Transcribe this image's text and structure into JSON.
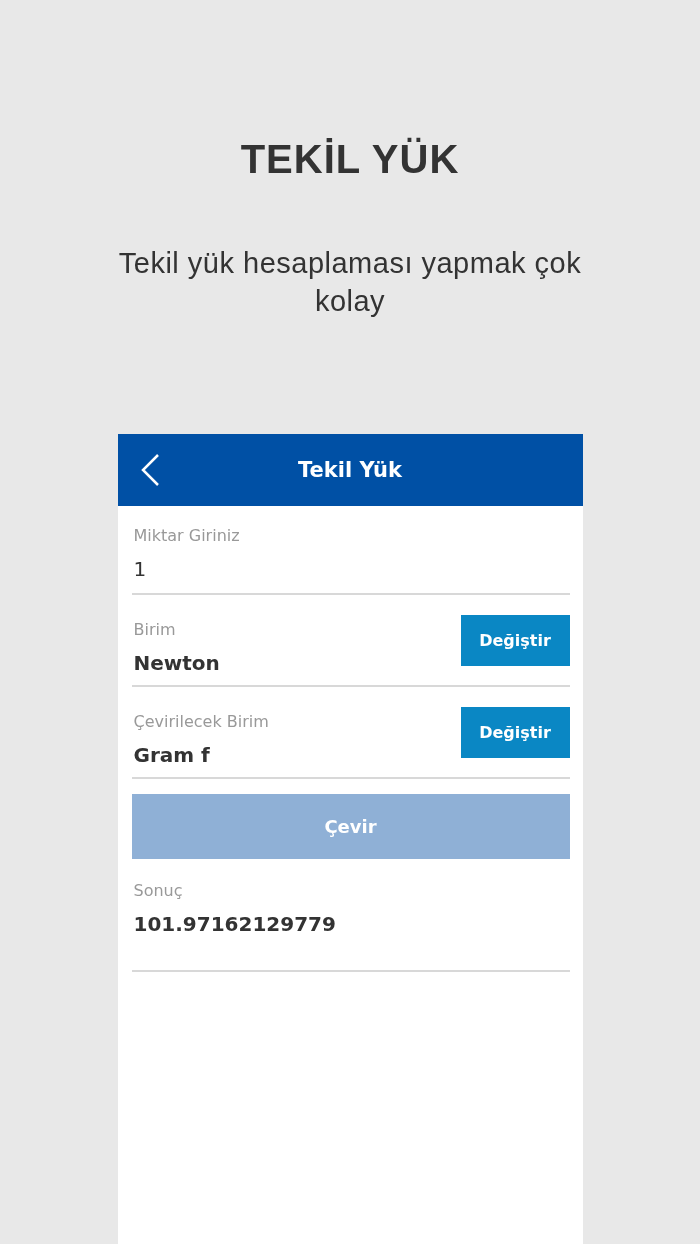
{
  "title": "TEKİL YÜK",
  "subtitle": "Tekil yük hesaplaması yapmak çok kolay",
  "app": {
    "header": {
      "title": "Tekil Yük"
    },
    "fields": [
      {
        "kind": "input",
        "label": "Miktar Giriniz",
        "value": "1"
      },
      {
        "kind": "unit",
        "label": "Birim",
        "value": "Newton",
        "button": "Değiştir"
      },
      {
        "kind": "unit",
        "label": "Çevirilecek Birim",
        "value": "Gram f",
        "button": "Değiştir"
      }
    ],
    "convert_button": {
      "label": "Çevir",
      "disabled": true
    },
    "result": {
      "label": "Sonuç",
      "value": "101.97162129779"
    }
  }
}
